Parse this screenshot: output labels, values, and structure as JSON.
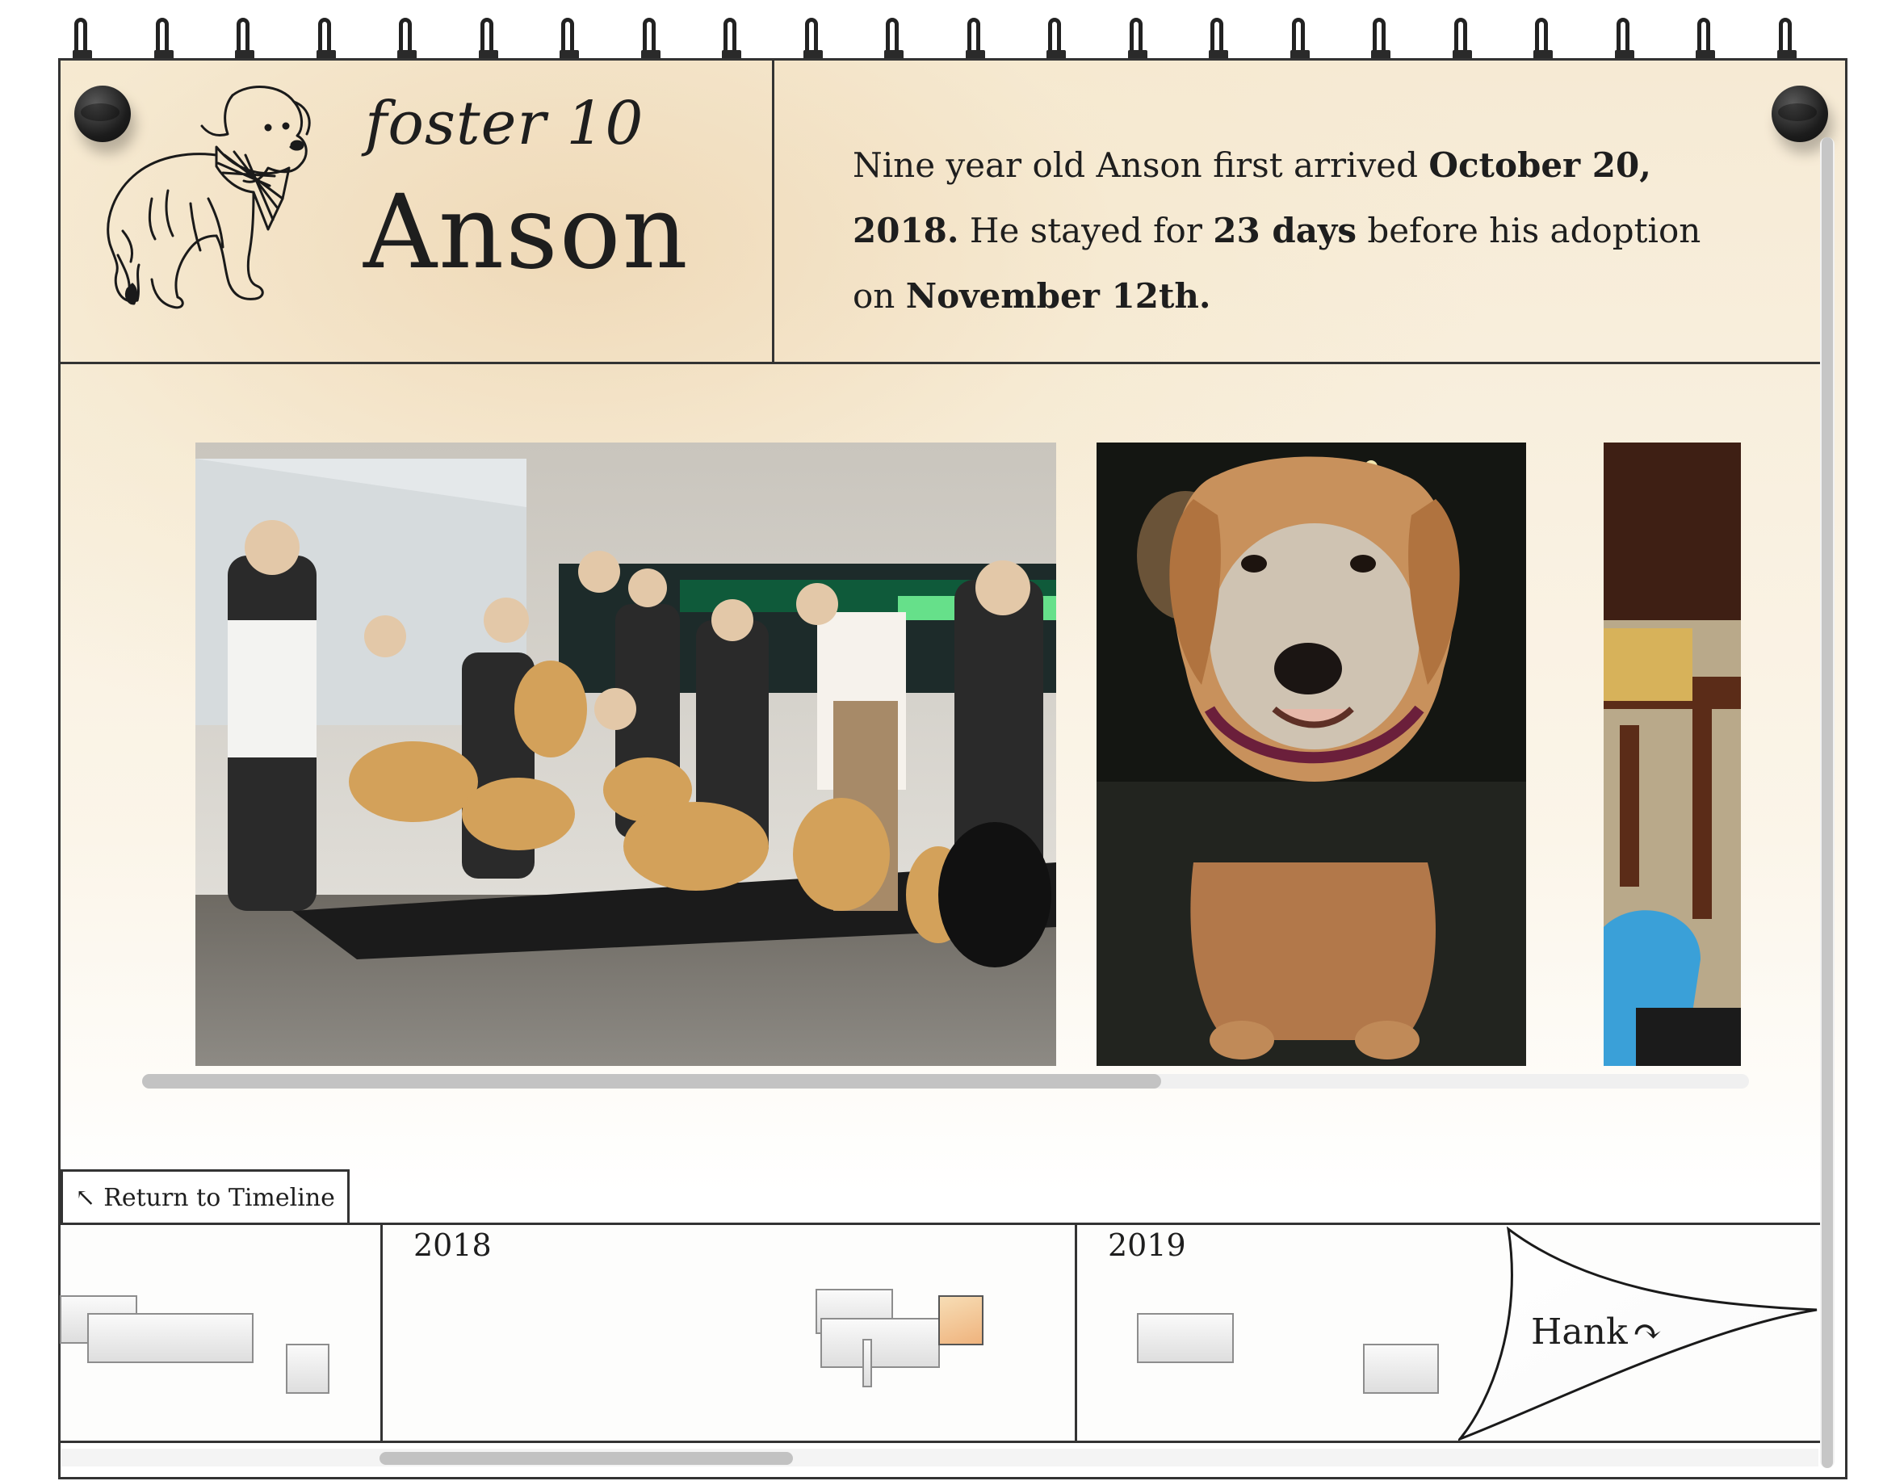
{
  "header": {
    "subtitle": "foster 10",
    "title": "Anson"
  },
  "story": {
    "p1": "Nine year old Anson first arrived ",
    "arrival_date": "October 20, 2018.",
    "p2": " He stayed for ",
    "days": "23 days",
    "p3": " before his adoption on ",
    "adoption_date": "November 12th."
  },
  "gallery": {
    "photos": [
      {
        "icon": "group-photo-airport"
      },
      {
        "icon": "golden-retriever-portrait"
      },
      {
        "icon": "room-photo-partial"
      }
    ]
  },
  "return_link": {
    "arrow": "↖",
    "label": "Return to Timeline"
  },
  "timeline": {
    "years": [
      "2018",
      "2019"
    ],
    "active_color": "#f0b57f"
  },
  "next": {
    "label": "Hank",
    "arrow": "↷"
  },
  "colors": {
    "paper": "#f6ead4",
    "ink": "#1e1e1e"
  }
}
